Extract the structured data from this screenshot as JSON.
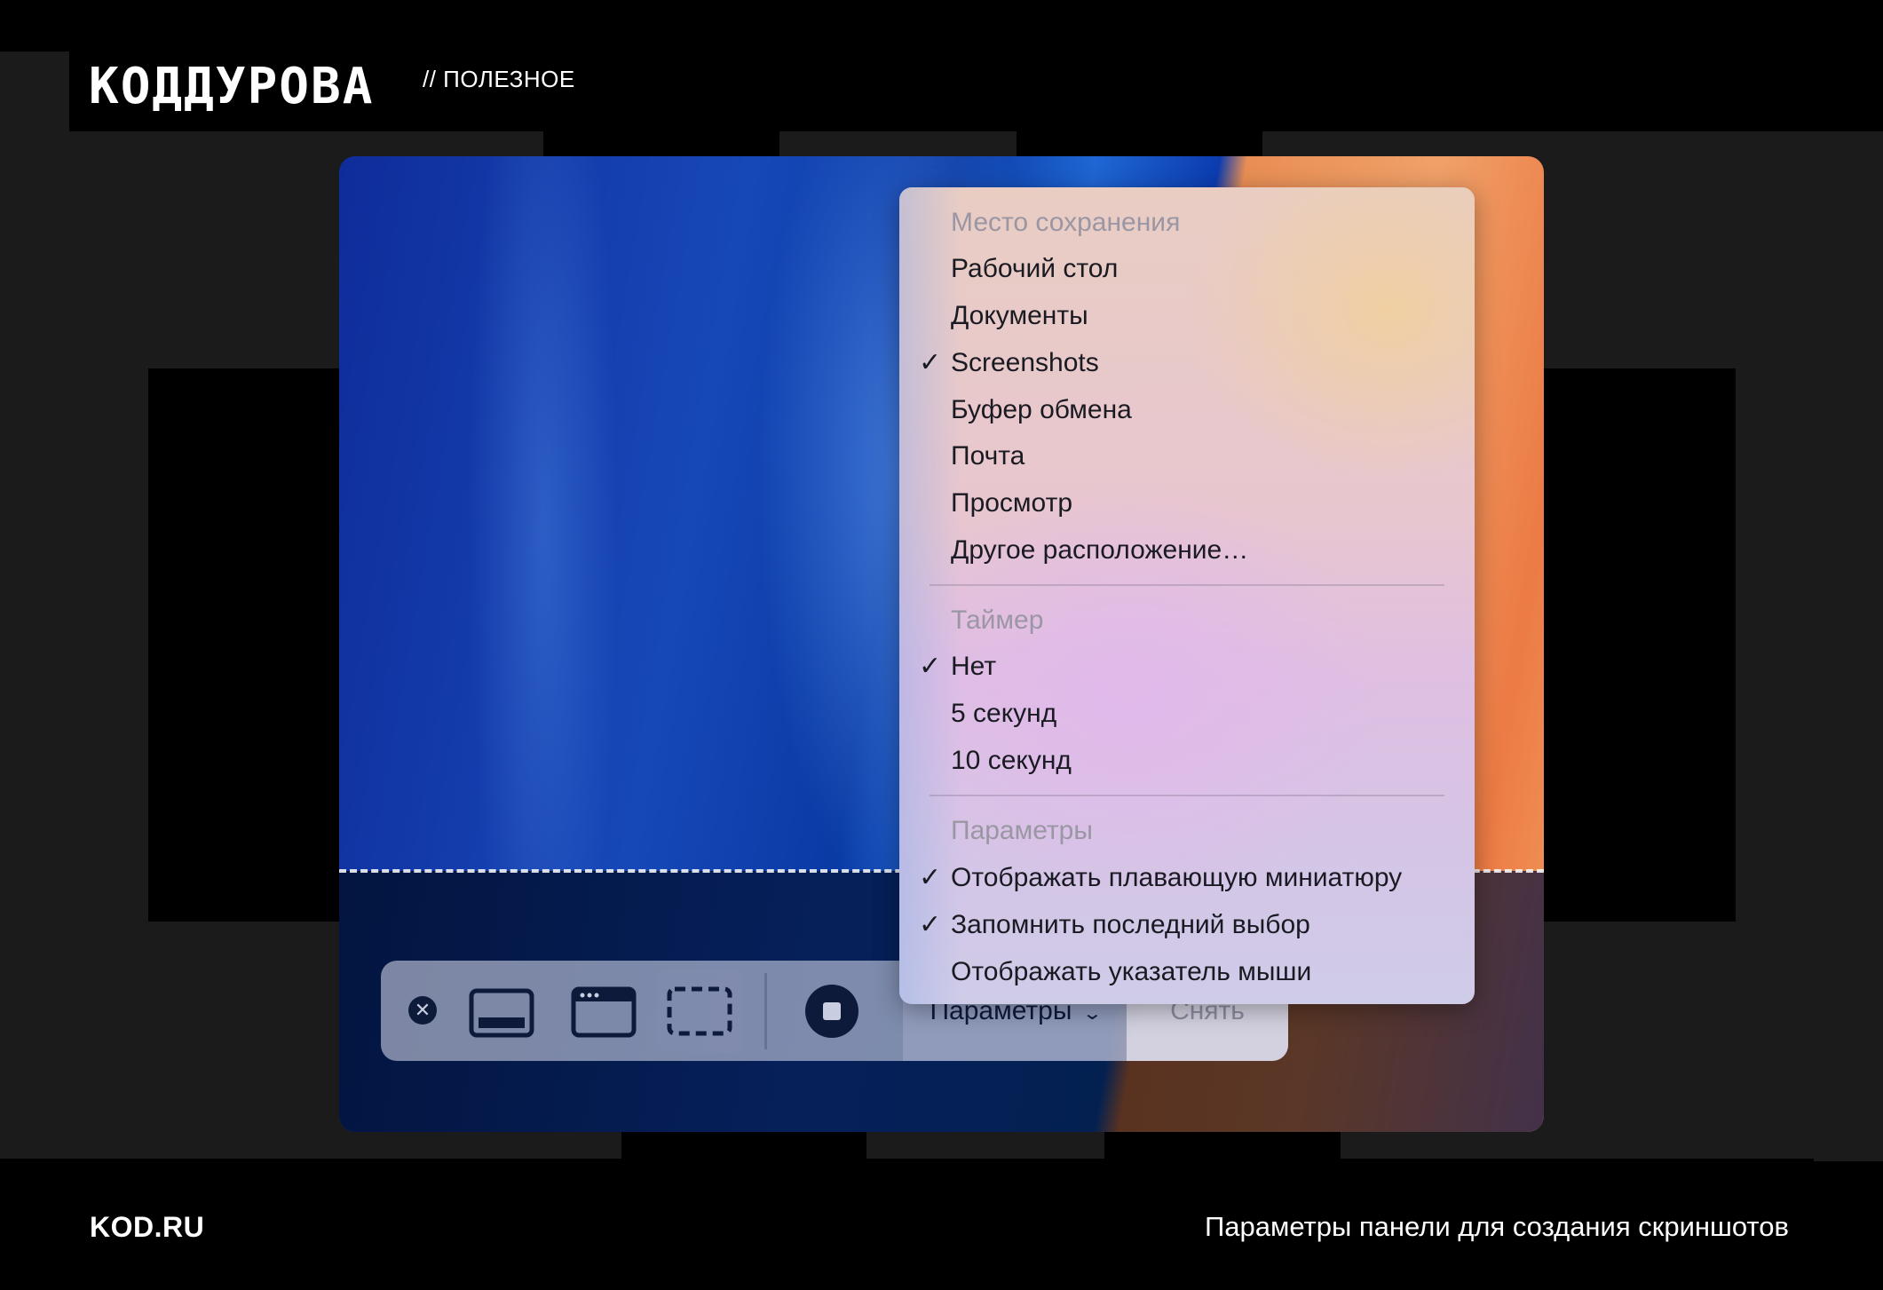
{
  "brand": {
    "logo": "КОДДУРОВА",
    "category": "// ПОЛЕЗНОЕ"
  },
  "footer": {
    "site": "KOD.RU",
    "caption": "Параметры панели для создания скриншотов"
  },
  "toolbar": {
    "close_icon": "close-icon",
    "buttons": [
      {
        "name": "capture-entire-screen",
        "icon": "screen-icon",
        "selected": false
      },
      {
        "name": "capture-window",
        "icon": "window-icon",
        "selected": false
      },
      {
        "name": "capture-selection",
        "icon": "selection-icon",
        "selected": true
      }
    ],
    "record_icon": "record-icon",
    "options_label": "Параметры",
    "capture_label": "Снять"
  },
  "menu": {
    "save_location": {
      "header": "Место сохранения",
      "items": [
        {
          "label": "Рабочий стол",
          "checked": false
        },
        {
          "label": "Документы",
          "checked": false
        },
        {
          "label": "Screenshots",
          "checked": true
        },
        {
          "label": "Буфер обмена",
          "checked": false
        },
        {
          "label": "Почта",
          "checked": false
        },
        {
          "label": "Просмотр",
          "checked": false
        },
        {
          "label": "Другое расположение…",
          "checked": false
        }
      ]
    },
    "timer": {
      "header": "Таймер",
      "items": [
        {
          "label": "Нет",
          "checked": true
        },
        {
          "label": "5 секунд",
          "checked": false
        },
        {
          "label": "10 секунд",
          "checked": false
        }
      ]
    },
    "options": {
      "header": "Параметры",
      "items": [
        {
          "label": "Отображать плавающую миниатюру",
          "checked": true
        },
        {
          "label": "Запомнить последний выбор",
          "checked": true
        },
        {
          "label": "Отображать указатель мыши",
          "checked": false
        }
      ]
    },
    "check_mark": "✓"
  }
}
